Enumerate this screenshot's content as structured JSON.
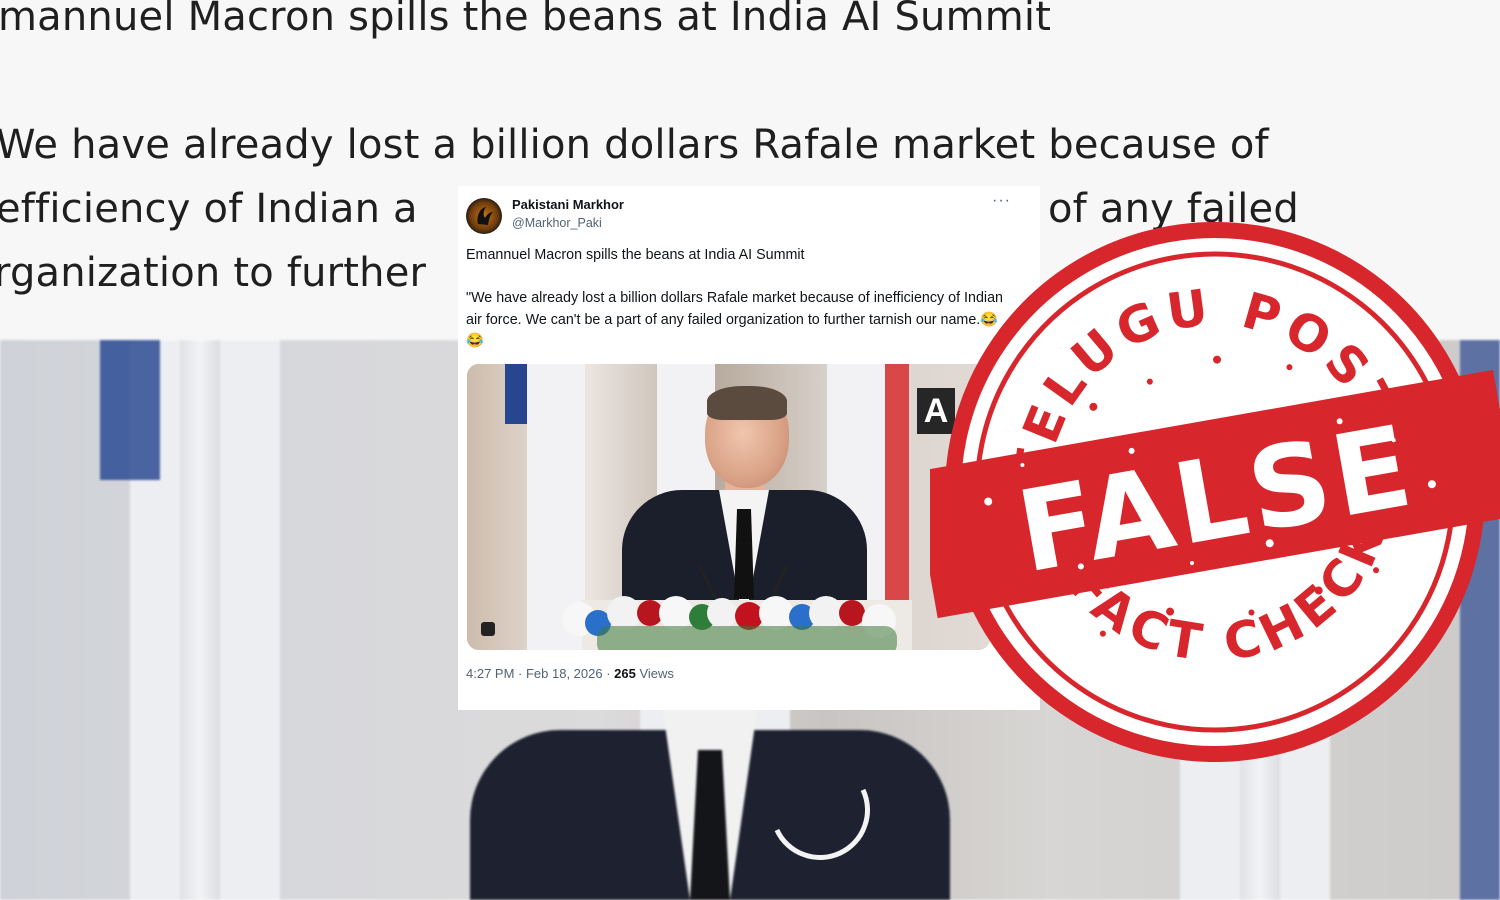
{
  "background_post": {
    "line1": "mannuel Macron spills the beans at India AI Summit",
    "line2": "We have already lost a billion dollars Rafale market because of",
    "line3_left": "efficiency of Indian a",
    "line3_right": "of any failed",
    "line4": "rganization to further"
  },
  "tweet": {
    "display_name": "Pakistani Markhor",
    "handle": "@Markhor_Paki",
    "more_label": "···",
    "text_line1": "Emannuel Macron spills the beans at India AI Summit",
    "text_line2": "\"We have already lost a billion dollars Rafale market because of inefficiency of Indian air force. We can't be a part of any failed organization to further tarnish our name.😂😂",
    "time": "4:27 PM · Feb 18, 2026 · ",
    "views_count": "265",
    "views_label": " Views",
    "media_logo": "A"
  },
  "stamp": {
    "top_text": "TELUGU POST",
    "main_text": "FALSE",
    "bottom_text": "FACT CHECK",
    "color": "#d7262c"
  }
}
